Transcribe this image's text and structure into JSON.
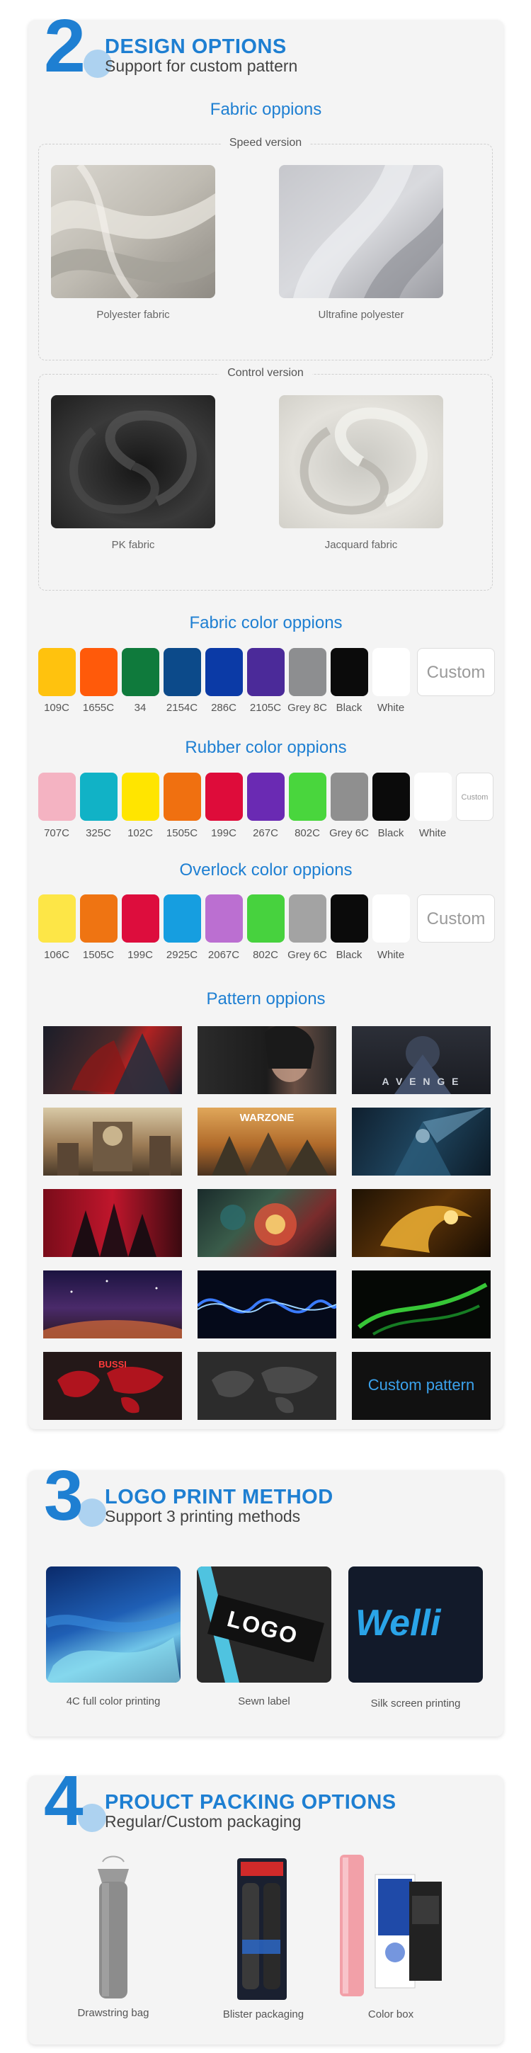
{
  "design": {
    "number": "2",
    "title": "DESIGN OPTIONS",
    "subtitle": "Support for custom pattern",
    "fabric_heading": "Fabric oppions",
    "speed_label": "Speed version",
    "speed_items": [
      "Polyester fabric",
      "Ultrafine polyester"
    ],
    "control_label": "Control version",
    "control_items": [
      "PK fabric",
      "Jacquard fabric"
    ],
    "fabric_color_heading": "Fabric color oppions",
    "fabric_colors": [
      {
        "name": "109C",
        "hex": "#ffc20e"
      },
      {
        "name": "1655C",
        "hex": "#ff5a0a"
      },
      {
        "name": "34",
        "hex": "#0f7a3c"
      },
      {
        "name": "2154C",
        "hex": "#0c4a8a"
      },
      {
        "name": "286C",
        "hex": "#0b3aa6"
      },
      {
        "name": "2105C",
        "hex": "#4b2a99"
      },
      {
        "name": "Grey 8C",
        "hex": "#8d8e90"
      },
      {
        "name": "Black",
        "hex": "#0b0b0b"
      },
      {
        "name": "White",
        "hex": "#ffffff"
      }
    ],
    "fabric_custom": "Custom",
    "rubber_heading": "Rubber color oppions",
    "rubber_colors": [
      {
        "name": "707C",
        "hex": "#f4b3c2"
      },
      {
        "name": "325C",
        "hex": "#11b2c6"
      },
      {
        "name": "102C",
        "hex": "#ffe500"
      },
      {
        "name": "1505C",
        "hex": "#f07010"
      },
      {
        "name": "199C",
        "hex": "#de0c3a"
      },
      {
        "name": "267C",
        "hex": "#6a2ab3"
      },
      {
        "name": "802C",
        "hex": "#49d63d"
      },
      {
        "name": "Grey 6C",
        "hex": "#8f8f8f"
      },
      {
        "name": "Black",
        "hex": "#0b0b0b"
      },
      {
        "name": "White",
        "hex": "#ffffff"
      }
    ],
    "rubber_custom": "Custom",
    "overlock_heading": "Overlock color oppions",
    "overlock_colors": [
      {
        "name": "106C",
        "hex": "#fde647"
      },
      {
        "name": "1505C",
        "hex": "#ef7412"
      },
      {
        "name": "199C",
        "hex": "#dd0d3d"
      },
      {
        "name": "2925C",
        "hex": "#169ee0"
      },
      {
        "name": "2067C",
        "hex": "#bb6fd1"
      },
      {
        "name": "802C",
        "hex": "#47d23e"
      },
      {
        "name": "Grey 6C",
        "hex": "#a3a3a3"
      },
      {
        "name": "Black",
        "hex": "#0b0b0b"
      },
      {
        "name": "White",
        "hex": "#ffffff"
      }
    ],
    "overlock_custom": "Custom",
    "pattern_heading": "Pattern oppions",
    "pattern_texts": {
      "warzone": "WARZONE",
      "avengers": "A V E N G E",
      "bussi": "BUSSI",
      "custom": "Custom pattern"
    }
  },
  "logo": {
    "number": "3",
    "title": "LOGO PRINT METHOD",
    "subtitle": "Support 3 printing methods",
    "items": [
      "4C full color printing",
      "Sewn label",
      "Silk screen printing"
    ],
    "label_text": "LOGO",
    "silk_text": "Welli"
  },
  "packing": {
    "number": "4",
    "title": "PROUCT PACKING OPTIONS",
    "subtitle": "Regular/Custom packaging",
    "items": [
      "Drawstring bag",
      "Blister  packaging",
      "Color box"
    ]
  },
  "colors": {
    "accent": "#1e7fd2",
    "card": "#f4f4f4"
  }
}
